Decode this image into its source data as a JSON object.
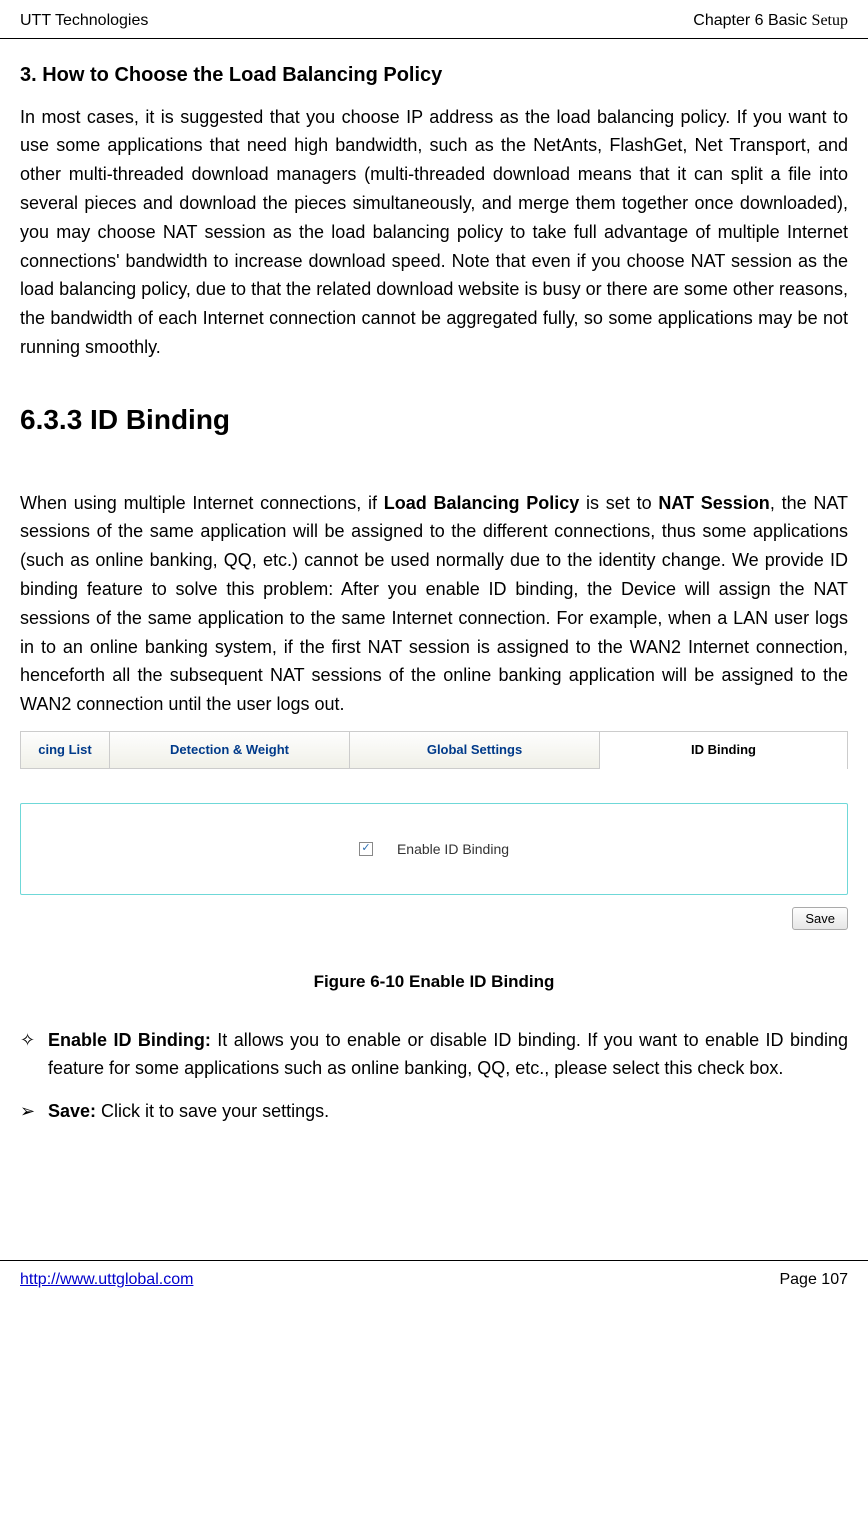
{
  "header": {
    "left": "UTT Technologies",
    "right_prefix": "Chapter 6 Basic ",
    "right_suffix": "Setup"
  },
  "section3": {
    "heading": "3.   How to Choose the Load Balancing Policy",
    "body": "In most cases, it is suggested that you choose IP address as the load balancing policy. If you want to use some applications that need high bandwidth, such as the NetAnts, FlashGet, Net Transport, and other multi-threaded download managers (multi-threaded download means that it can split a file into several pieces and download the pieces simultaneously, and merge them together once downloaded), you may choose NAT session as the load balancing policy to take full advantage of multiple Internet connections' bandwidth to increase download speed. Note that even if you choose NAT session as the load balancing policy, due to that the related download website is busy or there are some other reasons, the bandwidth of each Internet connection cannot be aggregated fully, so some applications may be not running smoothly."
  },
  "subsection": {
    "heading": "6.3.3   ID Binding",
    "body_part1": "When using multiple Internet connections, if ",
    "bold1": "Load Balancing Policy",
    "mid1": " is set to ",
    "bold2": "NAT Session",
    "body_part2": ", the NAT sessions of the same application will be assigned to the different connections, thus some applications (such as online banking, QQ, etc.) cannot be used normally due to the identity change. We provide ID binding feature to solve this problem: After you enable ID binding, the Device will assign the NAT sessions of the same application to the same Internet connection. For example, when a LAN user logs in to an online banking system, if the first NAT session is assigned to the WAN2 Internet connection, henceforth all the subsequent NAT sessions of the online banking application will be assigned to the WAN2 connection until the user logs out."
  },
  "tabs": {
    "t1": "cing List",
    "t2": "Detection & Weight",
    "t3": "Global Settings",
    "t4": "ID Binding"
  },
  "panel": {
    "checkbox_checked": true,
    "label": "Enable ID Binding"
  },
  "save_label": "Save",
  "figure_caption": "Figure 6-10 Enable ID Binding",
  "bullets": {
    "diamond": "✧",
    "arrow": "➢",
    "enable_bold": "Enable ID Binding:",
    "enable_text": " It allows you to enable or disable ID binding. If you want to enable ID binding feature for some applications such as online banking, QQ, etc., please select this check box.",
    "save_bold": "Save:",
    "save_text": " Click it to save your settings."
  },
  "footer": {
    "url": "http://www.uttglobal.com",
    "page": "Page 107"
  }
}
